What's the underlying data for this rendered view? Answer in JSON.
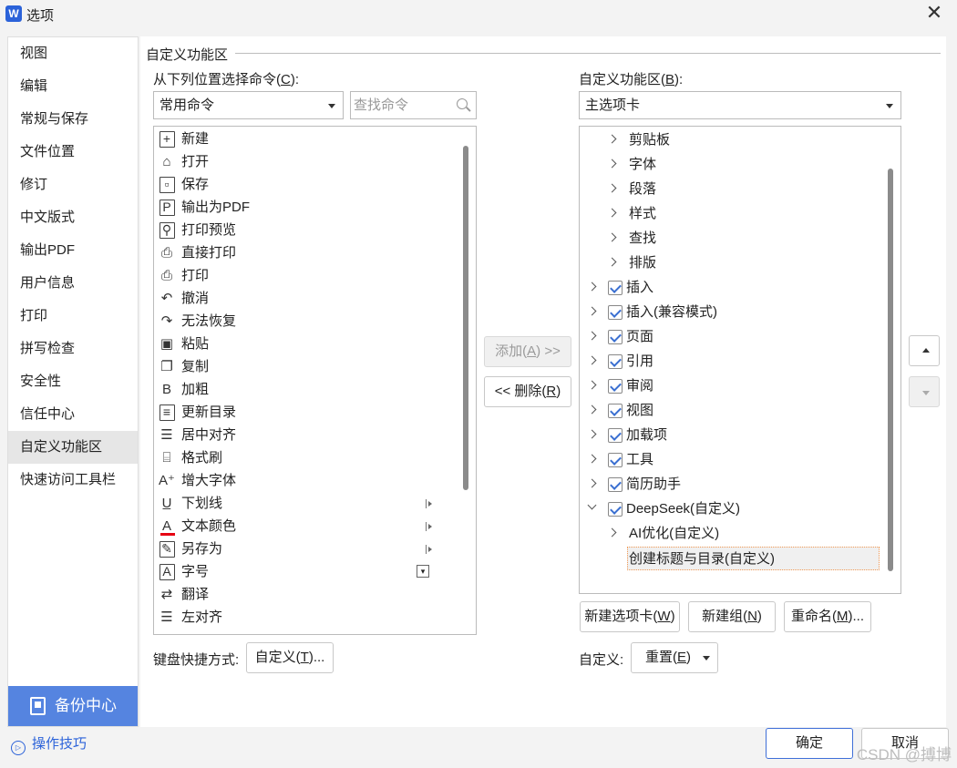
{
  "window": {
    "app_icon_letter": "W",
    "title": "选项",
    "close_glyph": "✕"
  },
  "sidebar": {
    "items": [
      {
        "label": "视图"
      },
      {
        "label": "编辑"
      },
      {
        "label": "常规与保存"
      },
      {
        "label": "文件位置"
      },
      {
        "label": "修订"
      },
      {
        "label": "中文版式"
      },
      {
        "label": "输出PDF"
      },
      {
        "label": "用户信息"
      },
      {
        "label": "打印"
      },
      {
        "label": "拼写检查"
      },
      {
        "label": "安全性"
      },
      {
        "label": "信任中心"
      },
      {
        "label": "自定义功能区",
        "active": true
      },
      {
        "label": "快速访问工具栏"
      }
    ],
    "backup_label": "备份中心",
    "tips_label": "操作技巧"
  },
  "section": {
    "title": "自定义功能区"
  },
  "left": {
    "label_prefix": "从下列位置选择命令(",
    "label_key": "C",
    "label_suffix": "):",
    "source_selected": "常用命令",
    "search_placeholder": "查找命令",
    "commands": [
      {
        "label": "新建",
        "icon": "new-doc-icon",
        "glyph": "+",
        "box": true
      },
      {
        "label": "打开",
        "icon": "open-folder-icon",
        "glyph": "⌂"
      },
      {
        "label": "保存",
        "icon": "save-icon",
        "glyph": "▫",
        "box": true
      },
      {
        "label": "输出为PDF",
        "icon": "export-pdf-icon",
        "glyph": "P",
        "box": true
      },
      {
        "label": "打印预览",
        "icon": "print-preview-icon",
        "glyph": "⚲",
        "box": true
      },
      {
        "label": "直接打印",
        "icon": "direct-print-icon",
        "glyph": "⎙"
      },
      {
        "label": "打印",
        "icon": "print-icon",
        "glyph": "⎙"
      },
      {
        "label": "撤消",
        "icon": "undo-icon",
        "glyph": "↶"
      },
      {
        "label": "无法恢复",
        "icon": "redo-icon",
        "glyph": "↷"
      },
      {
        "label": "粘贴",
        "icon": "paste-icon",
        "glyph": "▣"
      },
      {
        "label": "复制",
        "icon": "copy-icon",
        "glyph": "❐"
      },
      {
        "label": "加粗",
        "icon": "bold-icon",
        "glyph": "B"
      },
      {
        "label": "更新目录",
        "icon": "update-toc-icon",
        "glyph": "≡",
        "box": true
      },
      {
        "label": "居中对齐",
        "icon": "align-center-icon",
        "glyph": "☰"
      },
      {
        "label": "格式刷",
        "icon": "format-painter-icon",
        "glyph": "⌸"
      },
      {
        "label": "增大字体",
        "icon": "grow-font-icon",
        "glyph": "A⁺"
      },
      {
        "label": "下划线",
        "icon": "underline-icon",
        "glyph": "U̲",
        "sub": "arrow"
      },
      {
        "label": "文本颜色",
        "icon": "font-color-icon",
        "glyph": "A",
        "sub": "arrow",
        "redbar": true
      },
      {
        "label": "另存为",
        "icon": "save-as-icon",
        "glyph": "✎",
        "box": true,
        "sub": "arrow"
      },
      {
        "label": "字号",
        "icon": "font-size-icon",
        "glyph": "A",
        "box": true,
        "sub": "box"
      },
      {
        "label": "翻译",
        "icon": "translate-icon",
        "glyph": "⇄"
      },
      {
        "label": "左对齐",
        "icon": "align-left-icon",
        "glyph": "☰"
      }
    ],
    "shortcut_label": "键盘快捷方式:",
    "customize_prefix": "自定义(",
    "customize_key": "T",
    "customize_suffix": ")..."
  },
  "middle": {
    "add_prefix": "添加(",
    "add_key": "A",
    "add_suffix": ") >>",
    "remove_prefix": "<< 删除(",
    "remove_key": "R",
    "remove_suffix": ")"
  },
  "right": {
    "label_prefix": "自定义功能区(",
    "label_key": "B",
    "label_suffix": "):",
    "target_selected": "主选项卡",
    "tree": [
      {
        "label": "剪贴板",
        "level": 2,
        "expand": "collapsed",
        "checkbox": false
      },
      {
        "label": "字体",
        "level": 2,
        "expand": "collapsed",
        "checkbox": false
      },
      {
        "label": "段落",
        "level": 2,
        "expand": "collapsed",
        "checkbox": false
      },
      {
        "label": "样式",
        "level": 2,
        "expand": "collapsed",
        "checkbox": false
      },
      {
        "label": "查找",
        "level": 2,
        "expand": "collapsed",
        "checkbox": false
      },
      {
        "label": "排版",
        "level": 2,
        "expand": "collapsed",
        "checkbox": false
      },
      {
        "label": "插入",
        "level": 1,
        "expand": "collapsed",
        "checkbox": true
      },
      {
        "label": "插入(兼容模式)",
        "level": 1,
        "expand": "collapsed",
        "checkbox": true
      },
      {
        "label": "页面",
        "level": 1,
        "expand": "collapsed",
        "checkbox": true
      },
      {
        "label": "引用",
        "level": 1,
        "expand": "collapsed",
        "checkbox": true
      },
      {
        "label": "审阅",
        "level": 1,
        "expand": "collapsed",
        "checkbox": true
      },
      {
        "label": "视图",
        "level": 1,
        "expand": "collapsed",
        "checkbox": true
      },
      {
        "label": "加载项",
        "level": 1,
        "expand": "collapsed",
        "checkbox": true
      },
      {
        "label": "工具",
        "level": 1,
        "expand": "collapsed",
        "checkbox": true
      },
      {
        "label": "简历助手",
        "level": 1,
        "expand": "collapsed",
        "checkbox": true
      },
      {
        "label": "DeepSeek(自定义)",
        "level": 1,
        "expand": "expanded",
        "checkbox": true
      },
      {
        "label": "AI优化(自定义)",
        "level": 2,
        "expand": "collapsed",
        "checkbox": false
      },
      {
        "label": "创建标题与目录(自定义)",
        "level": 3,
        "expand": "none",
        "checkbox": false,
        "selected": true
      }
    ],
    "new_tab_prefix": "新建选项卡(",
    "new_tab_key": "W",
    "new_tab_suffix": ")",
    "new_group_prefix": "新建组(",
    "new_group_key": "N",
    "new_group_suffix": ")",
    "rename_prefix": "重命名(",
    "rename_key": "M",
    "rename_suffix": ")...",
    "customize_label": "自定义:",
    "reset_prefix": "重置(",
    "reset_key": "E",
    "reset_suffix": ")"
  },
  "footer": {
    "ok_label": "确定",
    "cancel_label": "取消",
    "watermark": "CSDN @搏博"
  },
  "colors": {
    "accent": "#5584e0",
    "link": "#2b62d9",
    "checkmark": "#3a6fd1",
    "selection_border": "#f29a55",
    "text_color_bar": "#e60012"
  }
}
